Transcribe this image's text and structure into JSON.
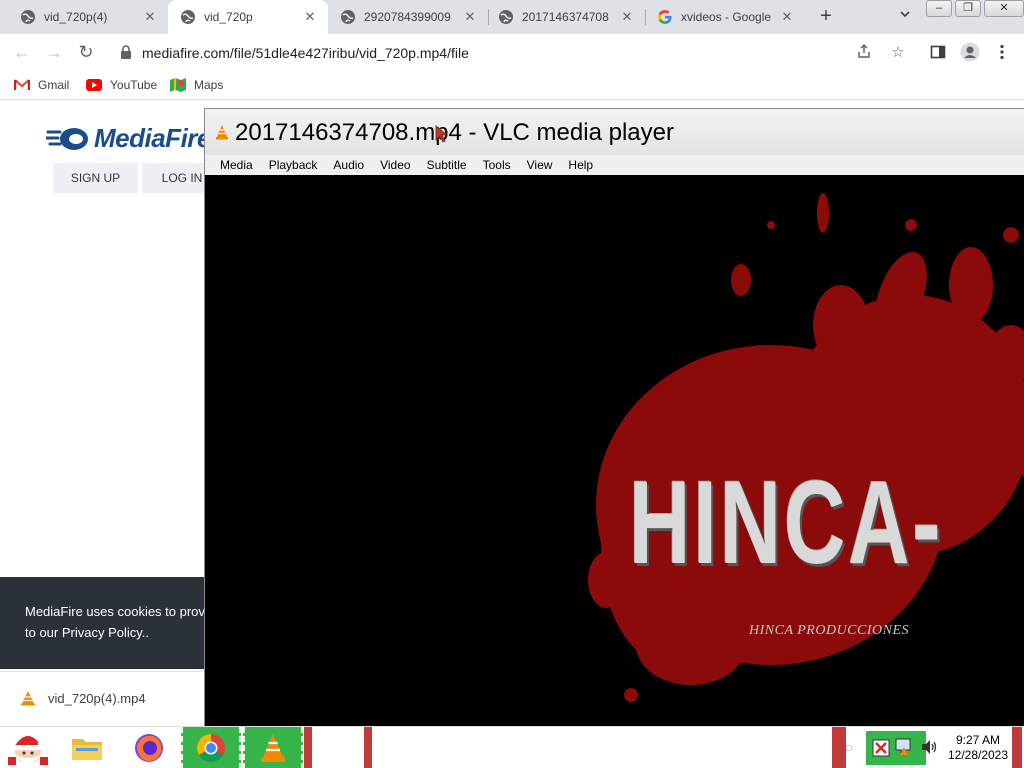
{
  "browser": {
    "tabs": [
      {
        "title": "vid_720p(4)",
        "icon": "globe-icon",
        "active": false
      },
      {
        "title": "vid_720p",
        "icon": "globe-icon",
        "active": true
      },
      {
        "title": "2920784399009",
        "icon": "globe-icon",
        "active": false
      },
      {
        "title": "2017146374708",
        "icon": "globe-icon",
        "active": false
      },
      {
        "title": "xvideos - Google",
        "icon": "google-icon",
        "active": false
      }
    ],
    "new_tab": "+",
    "url": "mediafire.com/file/51dle4e427iribu/vid_720p.mp4/file",
    "bookmarks": [
      {
        "label": "Gmail",
        "icon": "gmail-icon"
      },
      {
        "label": "YouTube",
        "icon": "youtube-icon"
      },
      {
        "label": "Maps",
        "icon": "maps-icon"
      }
    ]
  },
  "mediafire": {
    "logo": "MediaFire",
    "sign_up": "SIGN UP",
    "log_in": "LOG IN",
    "cookie_line1": "MediaFire uses cookies to prov",
    "cookie_line2": "to our Privacy Policy..",
    "download_file": "vid_720p(4).mp4"
  },
  "vlc": {
    "title": "2017146374708.mp4 - VLC media player",
    "menus": [
      "Media",
      "Playback",
      "Audio",
      "Video",
      "Subtitle",
      "Tools",
      "View",
      "Help"
    ],
    "video_text_big": "HINCA-",
    "video_text_sub": "HINCA PRODUCCIONES"
  },
  "taskbar": {
    "time": "9:27 AM",
    "date": "12/28/2023"
  },
  "colors": {
    "tab_strip": "#dee1e6",
    "mediafire_blue": "#1a4d8f",
    "cookie_bg": "#2b3138",
    "blood_red": "#8b0a0a",
    "taskbar_active": "#35b54a"
  }
}
